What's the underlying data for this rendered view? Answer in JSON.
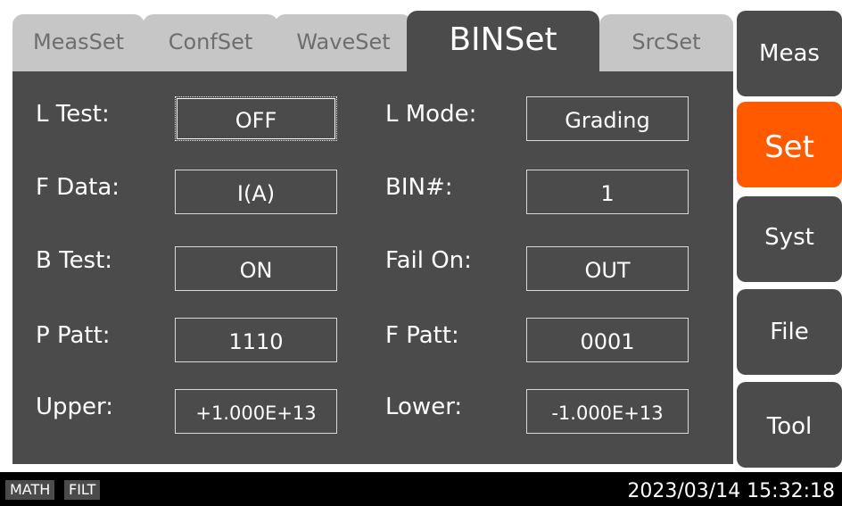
{
  "tabs": {
    "meas_set": "MeasSet",
    "conf_set": "ConfSet",
    "wave_set": "WaveSet",
    "bin_set": "BINSet",
    "src_set": "SrcSet"
  },
  "fields": {
    "l_test": {
      "label": "L Test:",
      "value": "OFF"
    },
    "l_mode": {
      "label": "L Mode:",
      "value": "Grading"
    },
    "f_data": {
      "label": "F Data:",
      "value": "I(A)"
    },
    "bin_num": {
      "label": "BIN#:",
      "value": "1"
    },
    "b_test": {
      "label": "B Test:",
      "value": "ON"
    },
    "fail_on": {
      "label": "Fail On:",
      "value": "OUT"
    },
    "p_patt": {
      "label": "P Patt:",
      "value": "1110"
    },
    "f_patt": {
      "label": "F Patt:",
      "value": "0001"
    },
    "upper": {
      "label": "Upper:",
      "value": "+1.000E+13"
    },
    "lower": {
      "label": "Lower:",
      "value": "-1.000E+13"
    }
  },
  "side_menu": {
    "meas": "Meas",
    "set": "Set",
    "syst": "Syst",
    "file": "File",
    "tool": "Tool"
  },
  "status": {
    "math": "MATH",
    "filt": "FILT",
    "datetime": "2023/03/14 15:32:18"
  },
  "colors": {
    "panel": "#4b4b4b",
    "accent": "#ff5a00",
    "inactive_tab": "#c6c6c6",
    "statusbar": "#000000"
  }
}
